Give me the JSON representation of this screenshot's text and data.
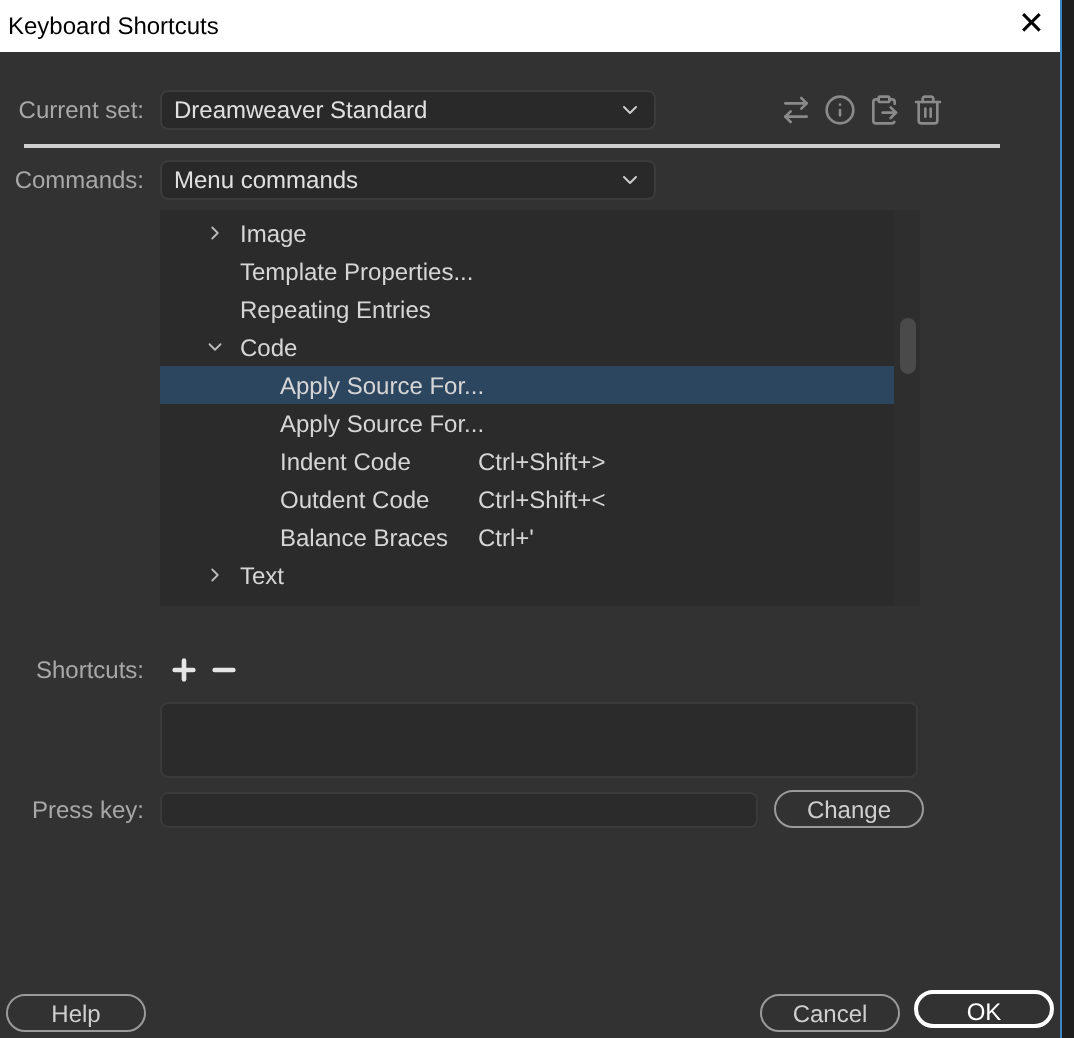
{
  "window": {
    "title": "Keyboard Shortcuts",
    "close": "✕"
  },
  "current_set": {
    "label": "Current set:",
    "value": "Dreamweaver Standard"
  },
  "commands": {
    "label": "Commands:",
    "value": "Menu commands"
  },
  "tree": [
    {
      "label": "Image",
      "expanded": false,
      "selected": false
    },
    {
      "label": "Template Properties...",
      "selected": false
    },
    {
      "label": "Repeating Entries",
      "selected": false
    },
    {
      "label": "Code",
      "expanded": true,
      "selected": false,
      "children": [
        {
          "label": "Apply Source For...",
          "selected": true
        },
        {
          "label": "Apply Source For...",
          "selected": false
        },
        {
          "label": "Indent Code",
          "shortcut": "Ctrl+Shift+>",
          "selected": false
        },
        {
          "label": "Outdent Code",
          "shortcut": "Ctrl+Shift+<",
          "selected": false
        },
        {
          "label": "Balance Braces",
          "shortcut": "Ctrl+'",
          "selected": false
        }
      ]
    },
    {
      "label": "Text",
      "expanded": false,
      "selected": false
    }
  ],
  "shortcuts": {
    "label": "Shortcuts:"
  },
  "press_key": {
    "label": "Press key:"
  },
  "buttons": [
    {
      "label": "Change",
      "kind": "change"
    },
    {
      "label": "Help",
      "kind": "help"
    },
    {
      "label": "Cancel",
      "kind": "cancel"
    },
    {
      "label": "OK",
      "kind": "ok"
    }
  ]
}
